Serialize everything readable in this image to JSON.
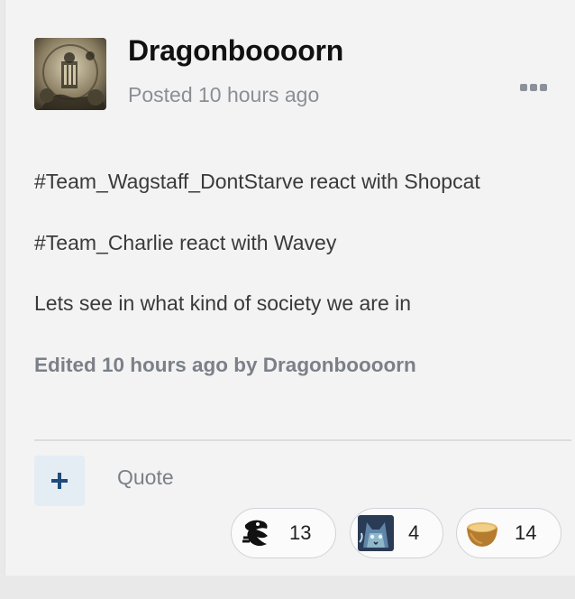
{
  "post": {
    "author": "Dragonboooorn",
    "posted_label": "Posted 10 hours ago",
    "lines": [
      "#Team_Wagstaff_DontStarve react with  Shopcat",
      "#Team_Charlie react with Wavey",
      "Lets see in what kind of society we are in"
    ],
    "edited_label": "Edited 10 hours ago by Dragonboooorn"
  },
  "actions": {
    "plus_icon": "plus-icon",
    "quote_label": "Quote",
    "more_icon": "more-dots-icon"
  },
  "reactions": [
    {
      "icon": "shopcat-emoji-icon",
      "count": "13"
    },
    {
      "icon": "wavey-cat-emoji-icon",
      "count": "4"
    },
    {
      "icon": "bowl-emoji-icon",
      "count": "14"
    }
  ],
  "colors": {
    "card_bg": "#f3f3f3",
    "page_bg": "#e9e9e9",
    "muted_text": "#8a8f96",
    "plus_bg": "#e4ecf4",
    "plus_fg": "#1f4b7a"
  }
}
